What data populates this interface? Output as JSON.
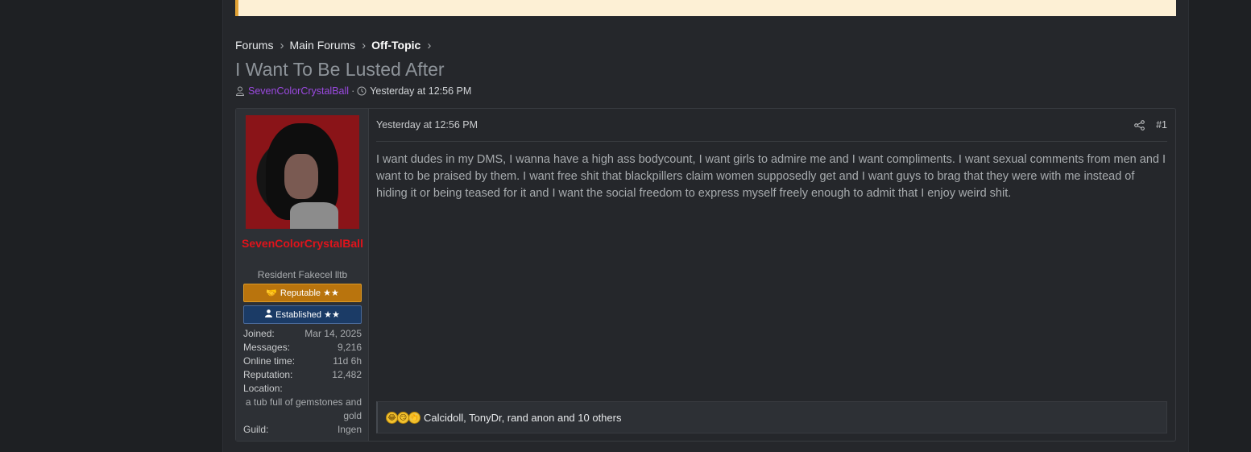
{
  "breadcrumb": [
    {
      "label": "Forums"
    },
    {
      "label": "Main Forums"
    },
    {
      "label": "Off-Topic"
    }
  ],
  "thread": {
    "title": "I Want To Be Lusted After",
    "author": "SevenColorCrystalBall",
    "date": "Yesterday at 12:56 PM"
  },
  "post": {
    "user": {
      "name": "SevenColorCrystalBall",
      "title": "Resident Fakecel lltb",
      "banners": [
        {
          "label": "Reputable ★★",
          "icon": "handshake-icon",
          "color": "#b9740d"
        },
        {
          "label": "Established ★★",
          "icon": "user-icon",
          "color": "#1b3b66"
        }
      ],
      "stats": {
        "joined_label": "Joined:",
        "joined": "Mar 14, 2025",
        "messages_label": "Messages:",
        "messages": "9,216",
        "online_label": "Online time:",
        "online": "11d 6h",
        "reputation_label": "Reputation:",
        "reputation": "12,482",
        "location_label": "Location:",
        "location": "a tub full of gemstones and gold",
        "guild_label": "Guild:",
        "guild": "Ingen"
      }
    },
    "date": "Yesterday at 12:56 PM",
    "number": "#1",
    "body": "I want dudes in my DMS, I wanna have a high ass bodycount, I want girls to admire me and I want compliments. I want sexual comments from men and I want to be praised by them. I want free shit that blackpillers claim women supposedly get and I want guys to brag that they were with me instead of hiding it or being teased for it and I want the social freedom to express myself freely enough to admit that I enjoy weird shit.",
    "reactions": {
      "emoji_icons": [
        "laughing-emoji-icon",
        "smirk-emoji-icon",
        "clapping-emoji-icon"
      ],
      "text": "Calcidoll, TonyDr, rand anon and 10 others"
    }
  },
  "colors": {
    "background": "#1e2023",
    "panel": "#25272b",
    "username": "#e0131b",
    "author_link": "#9b49e0",
    "notice": "#fdf0d5"
  }
}
